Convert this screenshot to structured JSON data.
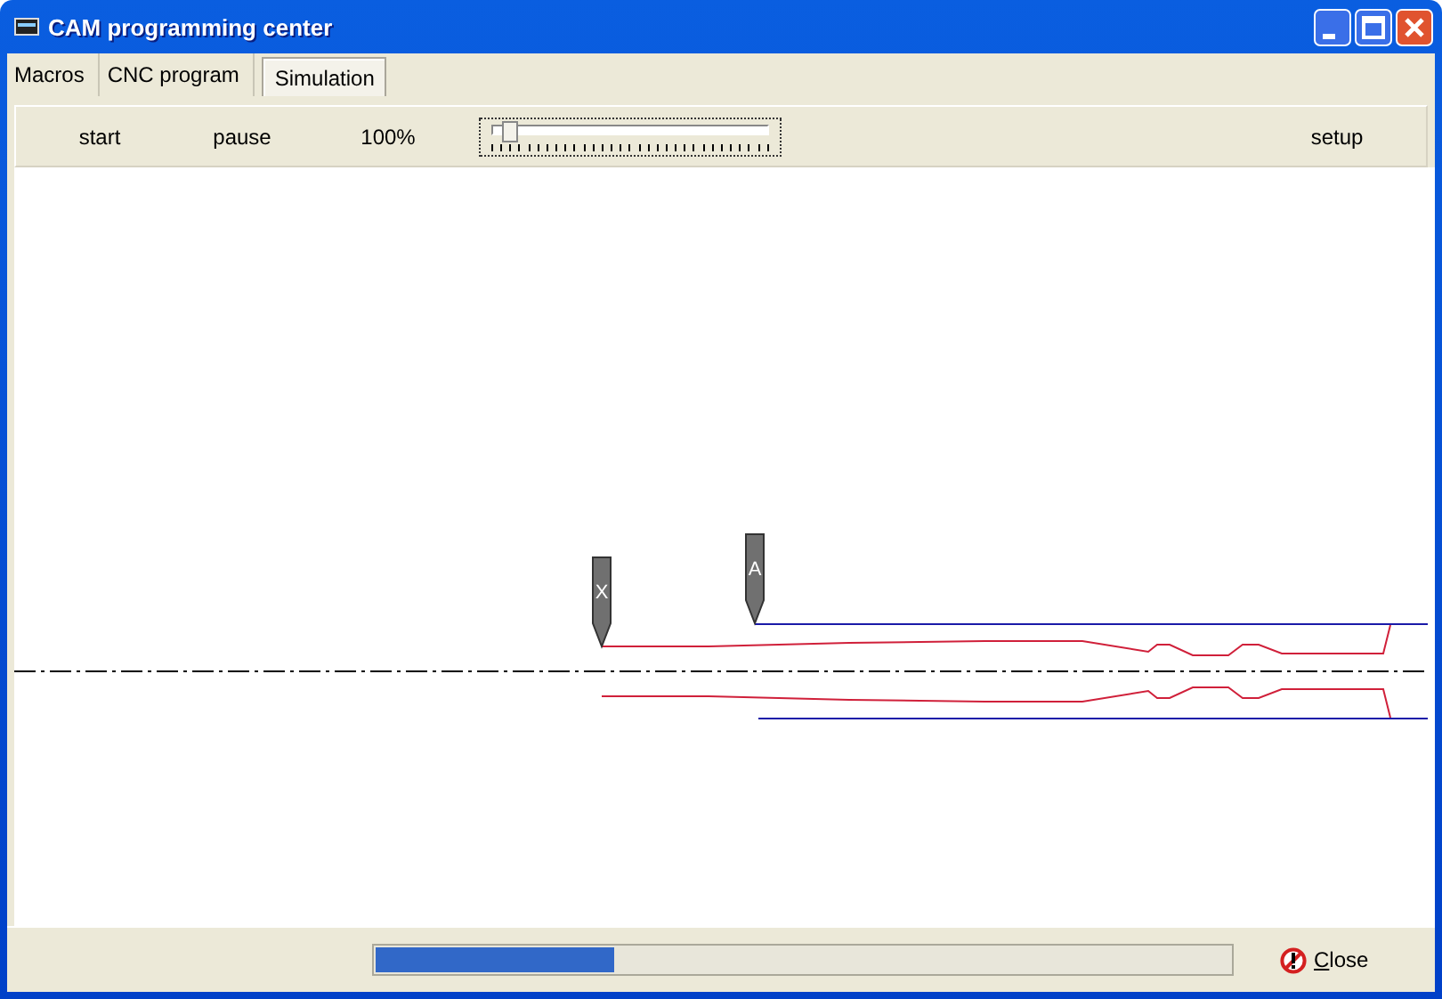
{
  "window": {
    "title": "CAM programming center"
  },
  "tabs": [
    {
      "label": "Macros",
      "selected": false
    },
    {
      "label": "CNC program",
      "selected": false
    },
    {
      "label": "Simulation",
      "selected": true
    }
  ],
  "toolbar": {
    "start": "start",
    "pause": "pause",
    "speed": "100%",
    "speed_slider": {
      "level": 0.06
    },
    "setup": "setup"
  },
  "simulation": {
    "tools": [
      {
        "label": "X"
      },
      {
        "label": "A"
      }
    ]
  },
  "status_bar": {
    "progress": {
      "level": 0.28
    },
    "close": "Close"
  }
}
